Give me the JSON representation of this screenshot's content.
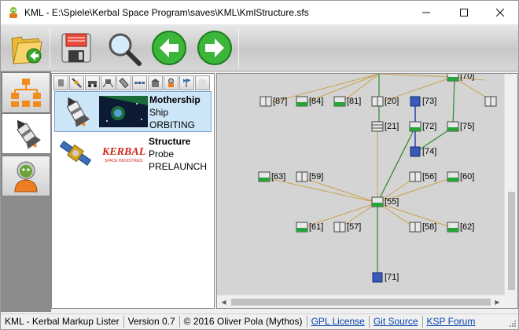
{
  "window": {
    "title": "KML - E:\\Spiele\\Kerbal Space Program\\saves\\KML\\KmlStructure.sfs",
    "minimize_icon": "minimize-icon",
    "maximize_icon": "maximize-icon",
    "close_icon": "close-icon"
  },
  "toolbar": {
    "buttons": [
      {
        "name": "open-button",
        "icon": "folder-open-icon"
      },
      {
        "name": "save-button",
        "icon": "floppy-disk-icon"
      },
      {
        "name": "search-button",
        "icon": "magnifier-icon"
      },
      {
        "name": "back-button",
        "icon": "arrow-left-icon"
      },
      {
        "name": "forward-button",
        "icon": "arrow-right-icon"
      }
    ]
  },
  "leftnav": {
    "items": [
      {
        "name": "tree-view-nav",
        "icon": "hierarchy-icon"
      },
      {
        "name": "vessels-nav",
        "icon": "rocket-icon"
      },
      {
        "name": "kerbals-nav",
        "icon": "kerbal-icon"
      }
    ]
  },
  "filters": [
    "debris-filter",
    "probe-filter",
    "rover-filter",
    "lander-filter",
    "ship-filter",
    "station-filter",
    "base-filter",
    "eva-filter",
    "flag-filter",
    "unknown-filter"
  ],
  "vessels": [
    {
      "name": "Mothership",
      "type": "Ship",
      "state": "ORBITING"
    },
    {
      "name": "Structure",
      "type": "Probe",
      "state": "PRELAUNCH"
    }
  ],
  "flag_text": "KERBAL",
  "flag_subtext": "SPACE INDUSTRIES",
  "graph": {
    "nodes": [
      {
        "label": "[87]"
      },
      {
        "label": "[84]"
      },
      {
        "label": "[81]"
      },
      {
        "label": "[20]"
      },
      {
        "label": "[73]"
      },
      {
        "label": "[21]"
      },
      {
        "label": "[72]"
      },
      {
        "label": "[75]"
      },
      {
        "label": "[74]"
      },
      {
        "label": "[63]"
      },
      {
        "label": "[59]"
      },
      {
        "label": "[56]"
      },
      {
        "label": "[60]"
      },
      {
        "label": "[55]"
      },
      {
        "label": "[61]"
      },
      {
        "label": "[57]"
      },
      {
        "label": "[58]"
      },
      {
        "label": "[62]"
      },
      {
        "label": "[71]"
      },
      {
        "label": "[70]"
      }
    ]
  },
  "status": {
    "app_name": "KML - Kerbal Markup Lister",
    "version": "Version 0.7",
    "copyright": "© 2016 Oliver Pola (Mythos)",
    "link_gpl": "GPL License",
    "link_git": "Git Source",
    "link_forum": "KSP Forum"
  }
}
